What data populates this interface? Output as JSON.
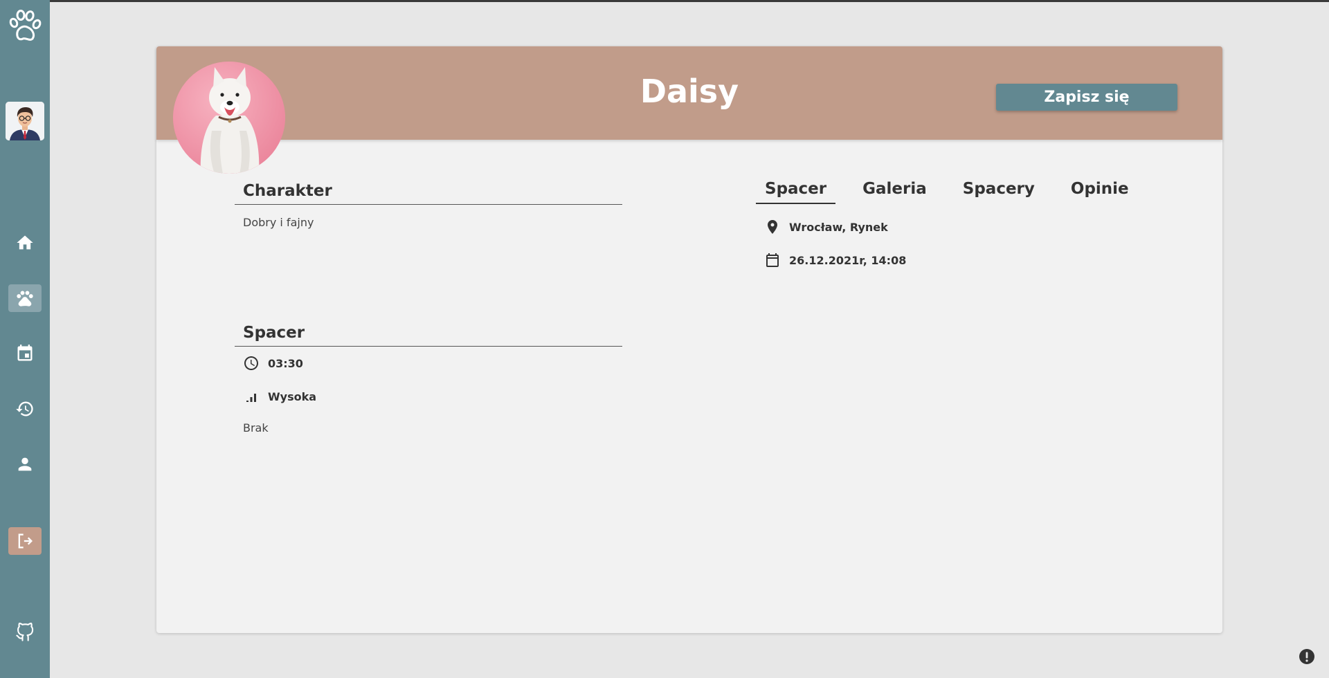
{
  "pet": {
    "name": "Daisy",
    "signup_label": "Zapisz się"
  },
  "character": {
    "title": "Charakter",
    "text": "Dobry i fajny"
  },
  "walk": {
    "title": "Spacer",
    "duration": "03:30",
    "intensity": "Wysoka",
    "notes": "Brak"
  },
  "tabs": [
    {
      "label": "Spacer",
      "active": true
    },
    {
      "label": "Galeria",
      "active": false
    },
    {
      "label": "Spacery",
      "active": false
    },
    {
      "label": "Opinie",
      "active": false
    }
  ],
  "walk_details": {
    "location": "Wrocław, Rynek",
    "datetime": "26.12.2021r, 14:08"
  },
  "sidebar": {
    "items": [
      {
        "icon": "home-icon"
      },
      {
        "icon": "paw-icon",
        "active": true
      },
      {
        "icon": "calendar-icon"
      },
      {
        "icon": "history-icon"
      },
      {
        "icon": "person-icon"
      },
      {
        "icon": "logout-icon"
      },
      {
        "icon": "github-icon"
      }
    ]
  },
  "colors": {
    "sidebar": "#628891",
    "header": "#c19c8a",
    "accent_button": "#628891",
    "background": "#e7e7e7",
    "card": "#f2f2f2"
  }
}
